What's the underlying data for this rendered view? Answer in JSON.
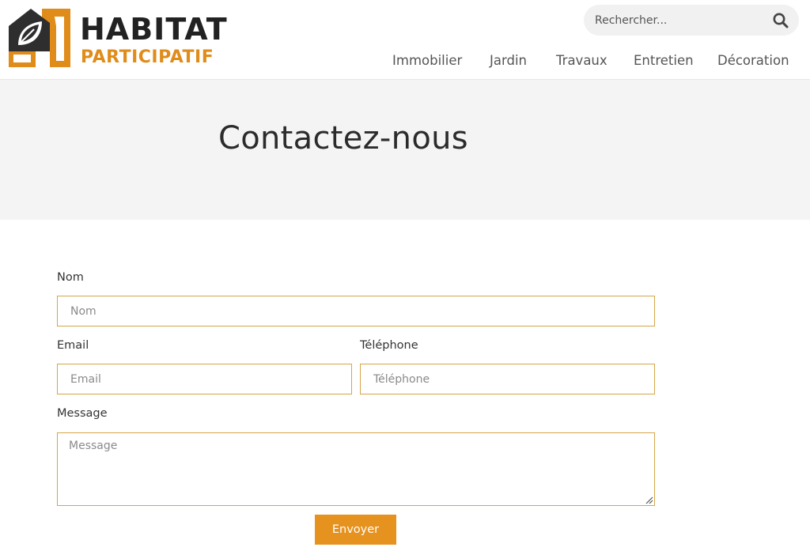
{
  "logo": {
    "line1": "HABITAT",
    "line2": "PARTICIPATIF"
  },
  "search": {
    "placeholder": "Rechercher...",
    "icon": "search-icon"
  },
  "nav": {
    "items": [
      {
        "label": "Immobilier"
      },
      {
        "label": "Jardin"
      },
      {
        "label": "Travaux"
      },
      {
        "label": "Entretien"
      },
      {
        "label": "Décoration"
      }
    ]
  },
  "hero": {
    "title": "Contactez-nous"
  },
  "form": {
    "name": {
      "label": "Nom",
      "placeholder": "Nom"
    },
    "email": {
      "label": "Email",
      "placeholder": "Email"
    },
    "phone": {
      "label": "Téléphone",
      "placeholder": "Téléphone"
    },
    "message": {
      "label": "Message",
      "placeholder": "Message"
    },
    "submit_label": "Envoyer"
  },
  "colors": {
    "brand_orange": "#e08c1a",
    "button_orange": "#e6921f",
    "field_border": "#d6a547",
    "hero_bg": "#f4f4f4",
    "text_dark": "#222222"
  }
}
